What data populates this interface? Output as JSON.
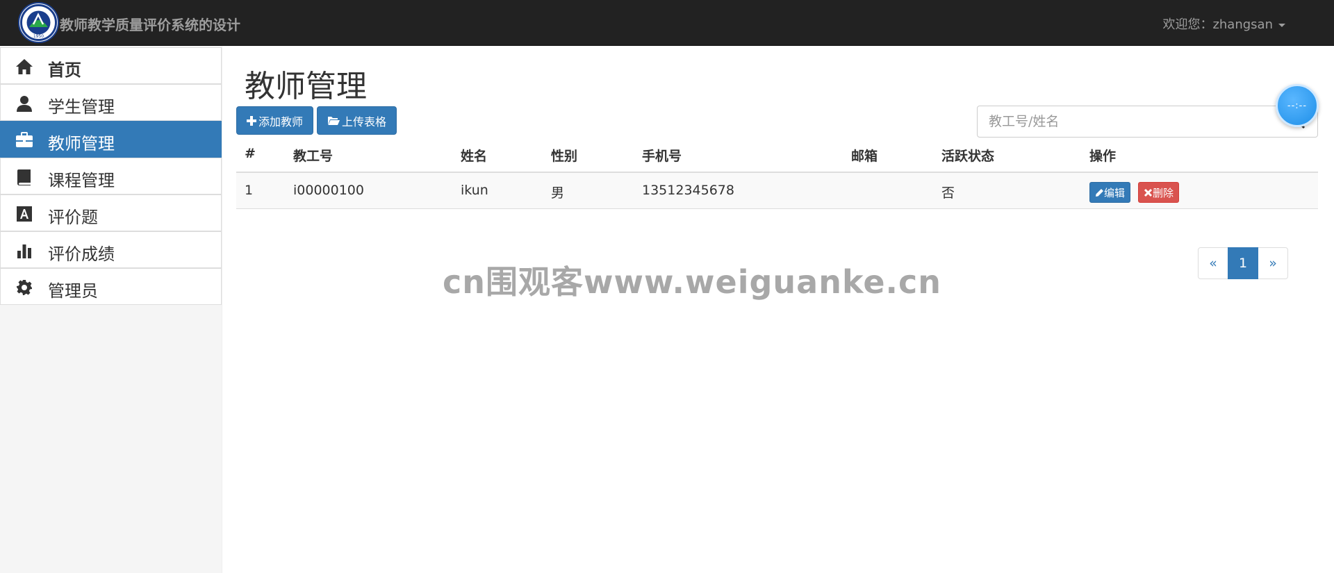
{
  "navbar": {
    "brand": "教师教学质量评价系统的设计",
    "welcome": "欢迎您：zhangsan",
    "logo_text": "1950"
  },
  "sidebar": {
    "items": [
      {
        "label": "首页",
        "icon": "home-icon",
        "active": false
      },
      {
        "label": "学生管理",
        "icon": "user-icon",
        "active": false
      },
      {
        "label": "教师管理",
        "icon": "briefcase-icon",
        "active": true
      },
      {
        "label": "课程管理",
        "icon": "book-icon",
        "active": false
      },
      {
        "label": "评价题",
        "icon": "text-icon",
        "active": false
      },
      {
        "label": "评价成绩",
        "icon": "bar-chart-icon",
        "active": false
      },
      {
        "label": "管理员",
        "icon": "gear-icon",
        "active": false
      }
    ]
  },
  "main": {
    "title": "教师管理",
    "add_button": "添加教师",
    "upload_button": "上传表格",
    "search_placeholder": "教工号/姓名",
    "float_ball_text": "--:--"
  },
  "table": {
    "headers": [
      "#",
      "教工号",
      "姓名",
      "性别",
      "手机号",
      "邮箱",
      "活跃状态",
      "操作"
    ],
    "rows": [
      {
        "index": "1",
        "emp_no": "i00000100",
        "name": "ikun",
        "gender": "男",
        "phone": "13512345678",
        "email": "",
        "active": "否"
      }
    ],
    "edit_label": "编辑",
    "delete_label": "删除"
  },
  "pagination": {
    "prev": "«",
    "current": "1",
    "next": "»"
  },
  "watermark": "cn围观客www.weiguanke.cn",
  "colors": {
    "primary": "#337ab7",
    "danger": "#d9534f",
    "navbar": "#222222"
  }
}
